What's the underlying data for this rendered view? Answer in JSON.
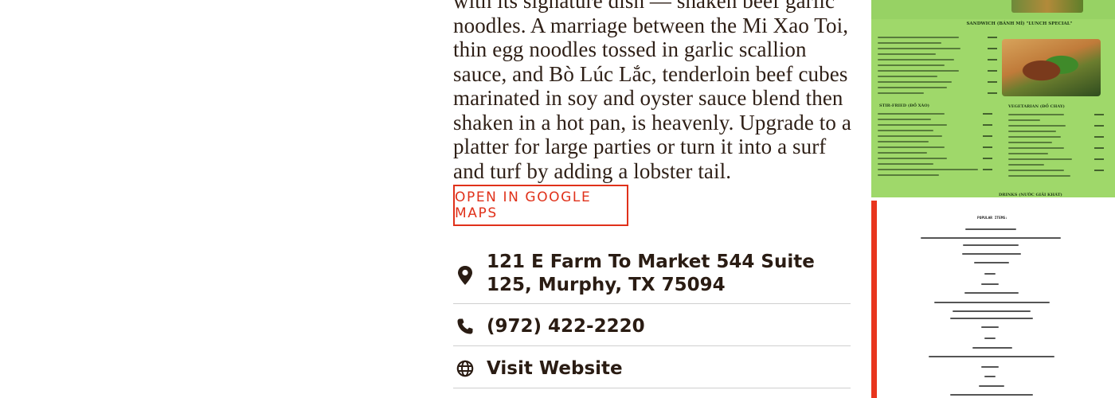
{
  "description": "with its signature dish — shaken beef garlic noodles. A marriage between the Mi Xao Toi, thin egg noodles tossed in garlic scallion sauce, and Bò Lúc Lắc, tenderloin beef cubes marinated in soy and oyster sauce blend then shaken in a hot pan, is heavenly. Upgrade to a platter for large parties or turn it into a surf and turf by adding a lobster tail.",
  "maps_button": {
    "label": "Open in Google Maps"
  },
  "contact": {
    "address": "121 E Farm To Market 544 Suite 125, Murphy, TX 75094",
    "phone": "(972) 422-2220",
    "website_label": "Visit Website"
  },
  "icons": {
    "address": "map-pin-icon",
    "phone": "phone-icon",
    "website": "globe-icon"
  },
  "photos": {
    "menu_green": {
      "section_title": "SANDWICH (BÁNH MÌ) \"LUNCH SPECIAL\"",
      "stir_fried_title": "STIR-FRIED (ĐỒ XÀO)",
      "vegetarian_title": "VEGETARIAN (ĐỒ CHAY)",
      "drinks_title": "DRINKS (NƯỚC GIẢI KHÁT)"
    },
    "menu_doc": {
      "title": "POPULAR ITEMS:"
    }
  },
  "colors": {
    "accent": "#e0311a",
    "text": "#2a1c13",
    "divider": "#cfcfcf",
    "menu_green": "#9fd86a"
  }
}
